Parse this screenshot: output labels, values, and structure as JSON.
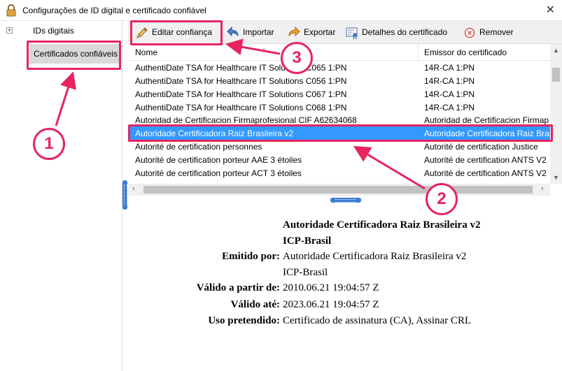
{
  "window": {
    "title": "Configurações de ID digital e certificado confiável",
    "close_glyph": "✕",
    "icon": "lock-icon"
  },
  "sidebar": {
    "items": [
      {
        "label": "IDs digitais",
        "expander": "+"
      },
      {
        "label": "Certificados confiáveis",
        "selected": true
      }
    ]
  },
  "toolbar": {
    "edit_trust": "Editar confiança",
    "import": "Importar",
    "export": "Exportar",
    "details": "Detalhes do certificado",
    "remove": "Remover"
  },
  "list": {
    "columns": {
      "name": "Nome",
      "issuer": "Emissor do certificado"
    },
    "rows": [
      {
        "name": "AuthentiDate TSA for Healthcare IT Solutions C065 1:PN",
        "issuer": "14R-CA 1:PN"
      },
      {
        "name": "AuthentiDate TSA for Healthcare IT Solutions C056 1:PN",
        "issuer": "14R-CA 1:PN"
      },
      {
        "name": "AuthentiDate TSA for Healthcare IT Solutions C067 1:PN",
        "issuer": "14R-CA 1:PN"
      },
      {
        "name": "AuthentiDate TSA for Healthcare IT Solutions C068 1:PN",
        "issuer": "14R-CA 1:PN"
      },
      {
        "name": "Autoridad de Certificacion Firmaprofesional CIF A62634068",
        "issuer": "Autoridad de Certificacion Firmap"
      },
      {
        "name": "Autoridade Certificadora Raiz Brasileira v2",
        "issuer": "Autoridade Certificadora Raiz Bras",
        "selected": true
      },
      {
        "name": "Autorité de certification personnes",
        "issuer": "Autorité de certification Justice"
      },
      {
        "name": "Autorité de certification porteur AAE 3 étoiles",
        "issuer": "Autorité de certification ANTS V2"
      },
      {
        "name": "Autorité de certification porteur ACT 3 étoiles",
        "issuer": "Autorité de certification ANTS V2"
      }
    ]
  },
  "details": {
    "name_line1": "Autoridade Certificadora Raiz Brasileira v2",
    "name_line2": "ICP-Brasil",
    "issued_by_label": "Emitido por:",
    "issued_by_line1": "Autoridade Certificadora Raiz Brasileira v2",
    "issued_by_line2": "ICP-Brasil",
    "valid_from_label": "Válido a partir de:",
    "valid_from": "2010.06.21 19:04:57 Z",
    "valid_to_label": "Válido até:",
    "valid_to": "2023.06.21 19:04:57 Z",
    "usage_label": "Uso pretendido:",
    "usage": "Certificado de assinatura (CA), Assinar CRL"
  },
  "annotations": {
    "color": "#e8245f",
    "step1": "1",
    "step2": "2",
    "step3": "3"
  },
  "colors": {
    "selection": "#3399ff",
    "splitter": "#3d7bd3"
  }
}
